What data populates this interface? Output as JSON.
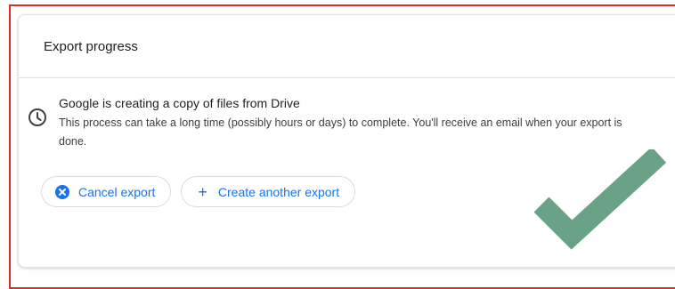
{
  "card": {
    "title": "Export progress"
  },
  "status": {
    "icon": "clock-icon",
    "title": "Google is creating a copy of files from Drive",
    "description": "This process can take a long time (possibly hours or days) to complete. You'll receive an email when your export is done."
  },
  "actions": {
    "cancel_label": "Cancel export",
    "cancel_icon": "cancel-circle-icon",
    "create_label": "Create another export",
    "create_icon": "plus-icon"
  },
  "overlay": {
    "icon": "checkmark-icon",
    "color": "#6aa287"
  },
  "colors": {
    "accent": "#1a73e8",
    "frame_border": "#d93025"
  }
}
